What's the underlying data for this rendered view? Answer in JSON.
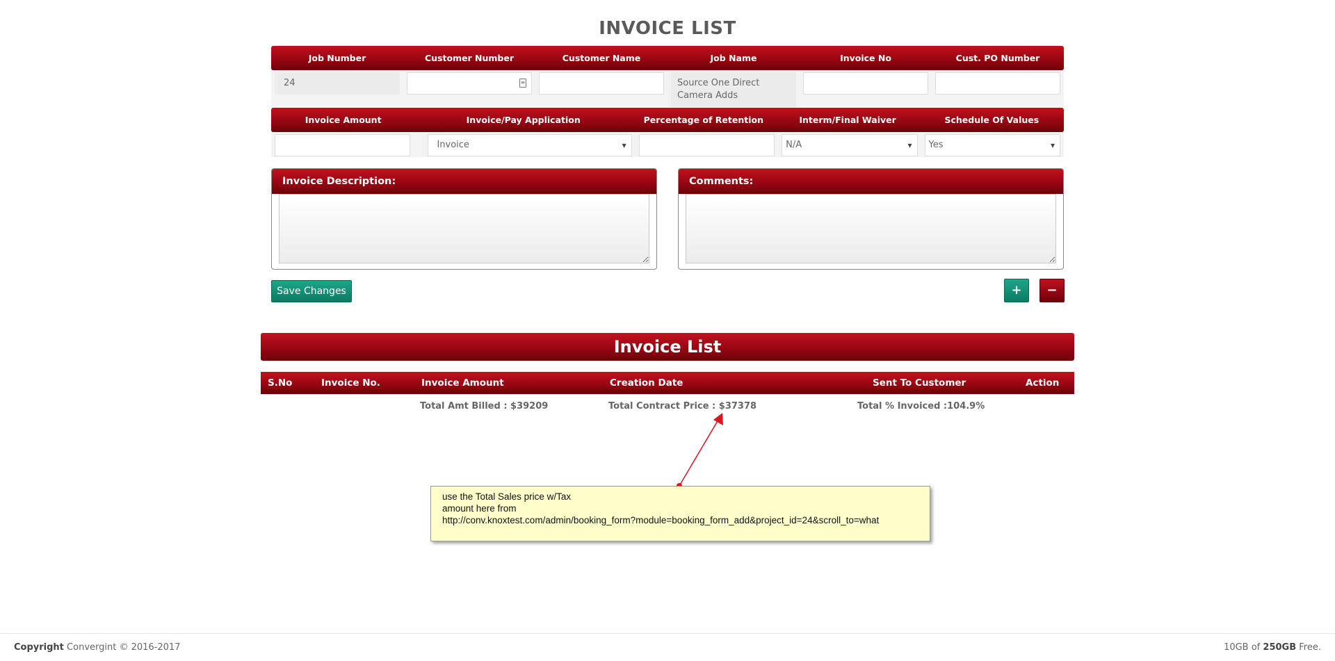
{
  "page": {
    "title": "INVOICE LIST"
  },
  "form": {
    "row1_headers": [
      "Job Number",
      "Customer Number",
      "Customer Name",
      "Job Name",
      "Invoice No",
      "Cust. PO Number"
    ],
    "job_number": "24",
    "customer_number": "",
    "customer_name": "",
    "job_name": "Source One Direct Camera Adds",
    "invoice_no": "",
    "cust_po_number": "",
    "row2_headers": [
      "Invoice Amount",
      "Invoice/Pay Application",
      "Percentage of Retention",
      "Interm/Final Waiver",
      "Schedule Of Values"
    ],
    "invoice_amount": "",
    "pay_application": "Invoice",
    "percentage_retention": "",
    "waiver": "N/A",
    "schedule_of_values": "Yes"
  },
  "panels": {
    "description_label": "Invoice Description:",
    "comments_label": "Comments:"
  },
  "buttons": {
    "save_label": "Save Changes",
    "add_label": "+",
    "remove_label": "−"
  },
  "invoice_list": {
    "title": "Invoice List",
    "columns": [
      "S.No",
      "Invoice No.",
      "Invoice Amount",
      "Creation Date",
      "Sent To Customer",
      "Action"
    ],
    "totals": {
      "amt_billed": "Total Amt Billed : $39209",
      "contract_price": "Total Contract Price : $37378",
      "percent_invoiced": "Total % Invoiced :104.9%"
    }
  },
  "annotation": {
    "line1": "use the Total Sales price w/Tax",
    "line2": "amount here from",
    "line3": "http://conv.knoxtest.com/admin/booking_form?module=booking_form_add&project_id=24&scroll_to=what"
  },
  "footer": {
    "copyright_bold": "Copyright",
    "copyright_text": "Convergint © 2016-2017",
    "storage_used": "10GB of",
    "storage_total": "250GB",
    "storage_suffix": "Free."
  },
  "colors": {
    "brand_red": "#a00814",
    "accent_green": "#0f8a6e",
    "note_bg": "#ffffcc"
  }
}
